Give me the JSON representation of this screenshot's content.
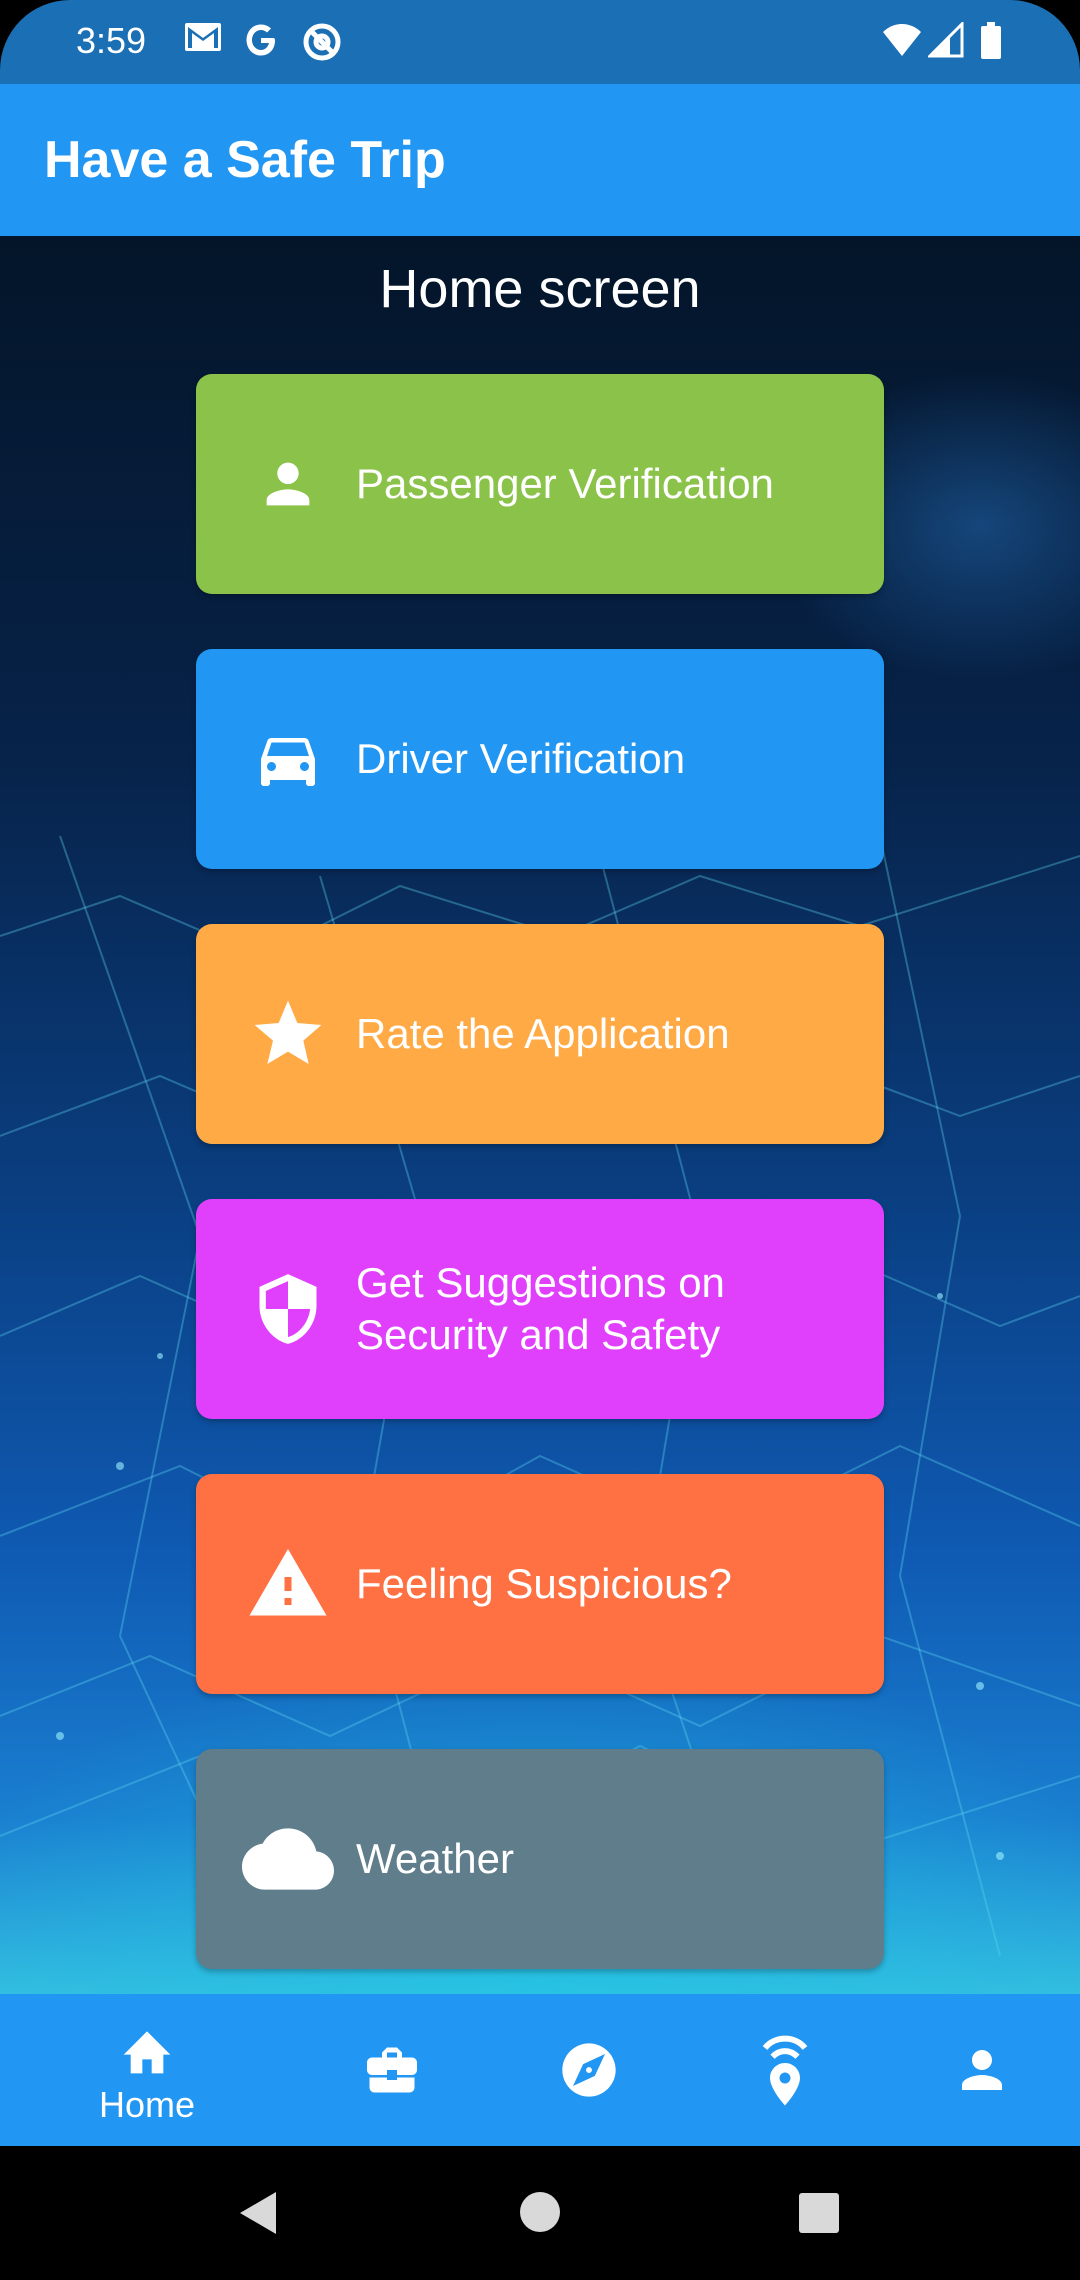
{
  "status_bar": {
    "time": "3:59",
    "left_icons": [
      "gmail-icon",
      "google-icon",
      "at-sign-icon"
    ],
    "right_icons": [
      "wifi-icon",
      "signal-icon",
      "battery-icon"
    ]
  },
  "app_bar": {
    "title": "Have a Safe Trip"
  },
  "main": {
    "heading": "Home screen",
    "cards": [
      {
        "label": "Passenger Verification",
        "icon": "person-icon",
        "color": "#8bc34a"
      },
      {
        "label": "Driver Verification",
        "icon": "car-icon",
        "color": "#2196f3"
      },
      {
        "label": "Rate the Application",
        "icon": "star-icon",
        "color": "#ffaa44"
      },
      {
        "label": "Get Suggestions on Security and Safety",
        "icon": "shield-icon",
        "color": "#e040fb"
      },
      {
        "label": "Feeling Suspicious?",
        "icon": "warning-icon",
        "color": "#ff7043"
      },
      {
        "label": "Weather",
        "icon": "cloud-icon",
        "color": "#607d8b"
      }
    ]
  },
  "bottom_nav": {
    "items": [
      {
        "label": "Home",
        "icon": "home-icon",
        "selected": true
      },
      {
        "label": "",
        "icon": "briefcase-icon",
        "selected": false
      },
      {
        "label": "",
        "icon": "compass-icon",
        "selected": false
      },
      {
        "label": "",
        "icon": "location-signal-icon",
        "selected": false
      },
      {
        "label": "",
        "icon": "person-icon",
        "selected": false
      }
    ]
  },
  "system_nav": {
    "buttons": [
      "back-icon",
      "home-circle-icon",
      "recents-icon"
    ]
  },
  "colors": {
    "app_bar": "#2196f3",
    "status_bar": "#1b6fb4"
  }
}
